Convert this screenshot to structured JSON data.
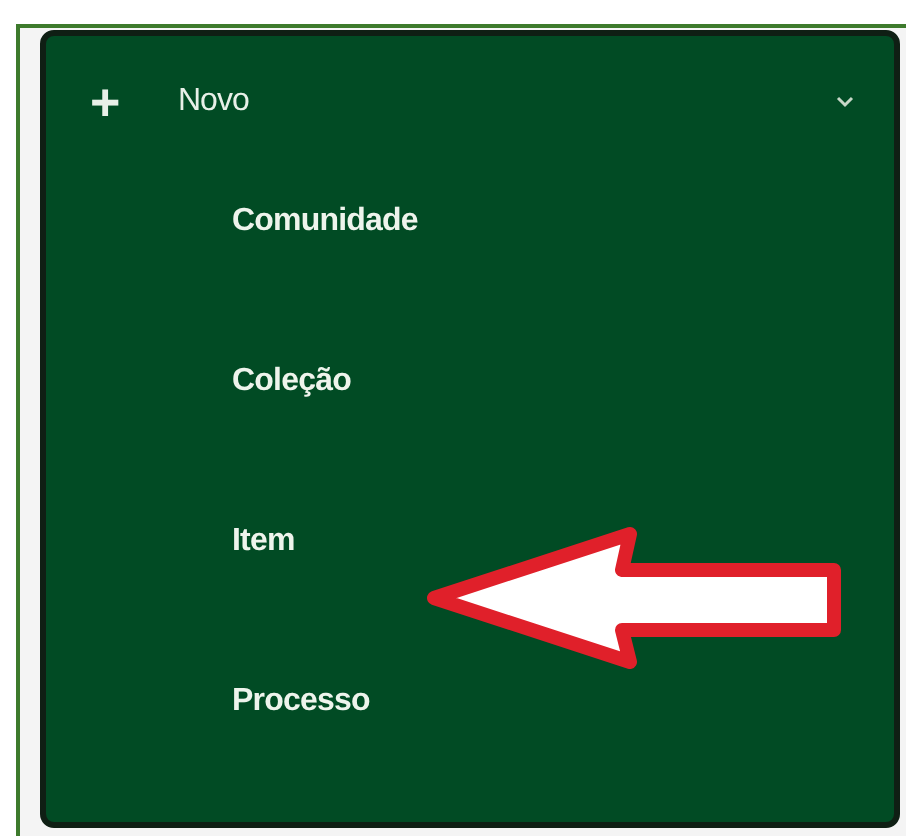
{
  "menu": {
    "icon": "+",
    "label": "Novo",
    "expanded": true,
    "items": [
      {
        "label": "Comunidade"
      },
      {
        "label": "Coleção"
      },
      {
        "label": "Item"
      },
      {
        "label": "Processo"
      }
    ]
  }
}
